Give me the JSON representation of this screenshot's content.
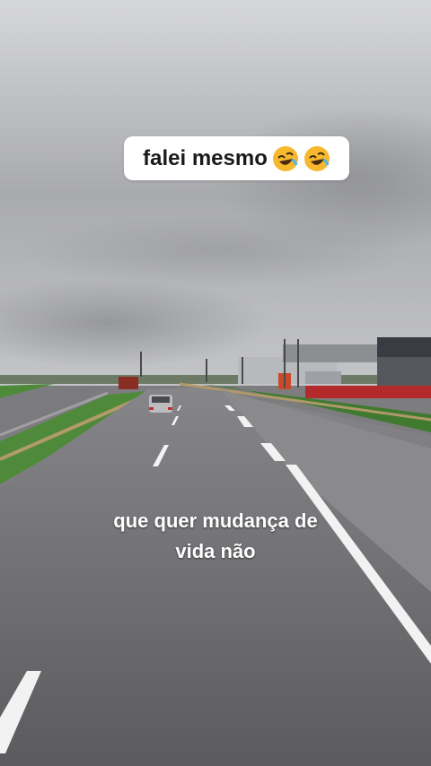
{
  "overlay": {
    "top_caption": "falei mesmo",
    "top_emojis": [
      "rolling-on-floor-laughing-emoji",
      "rolling-on-floor-laughing-emoji"
    ],
    "subtitle_line1": "que quer mudança de",
    "subtitle_line2": "vida não"
  },
  "colors": {
    "sky": "#c9cacc",
    "asphalt": "#6f6f71",
    "grass": "#4f8a3a",
    "caption_bg": "#ffffff",
    "emoji_face": "#f5b82e"
  }
}
